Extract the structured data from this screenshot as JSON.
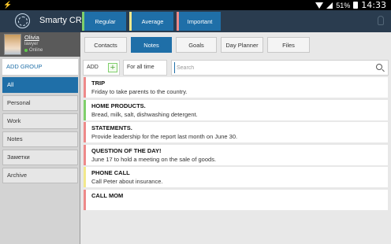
{
  "status_bar": {
    "battery": "51%",
    "time": "14:33"
  },
  "header": {
    "app_title": "Smarty CRM",
    "priorities": {
      "regular": "Regular",
      "average": "Average",
      "important": "Important"
    }
  },
  "profile": {
    "name": "Olivia",
    "role": "lawyer",
    "status": "Online"
  },
  "sidebar": {
    "add_group_label": "ADD GROUP",
    "groups": [
      "All",
      "Personal",
      "Work",
      "Notes",
      "Заметки",
      "Archive"
    ],
    "active_group": "All"
  },
  "tabs": [
    "Contacts",
    "Notes",
    "Goals",
    "Day Planner",
    "Files"
  ],
  "active_tab": "Notes",
  "toolbar": {
    "add_label": "ADD",
    "time_filter": "For all time",
    "search_placeholder": "Search"
  },
  "notes": [
    {
      "title": "TRIP",
      "body": "Friday to take parents to the country.",
      "priority": "important"
    },
    {
      "title": "HOME PRODUCTS.",
      "body": "Bread, milk, salt, dishwashing detergent.",
      "priority": "regular"
    },
    {
      "title": "STATEMENTS.",
      "body": "Provide leadership for the report last month on June 30.",
      "priority": "important"
    },
    {
      "title": "QUESTION OF THE DAY!",
      "body": "June 17 to hold a meeting on the sale of goods.",
      "priority": "important"
    },
    {
      "title": "PHONE CALL",
      "body": "Call Peter about insurance.",
      "priority": "average"
    },
    {
      "title": "CALL MOM",
      "body": "",
      "priority": "important"
    }
  ],
  "colors": {
    "accent": "#1f6fa8",
    "header_bg": "#2a3c4f",
    "regular": "#7fcf6b",
    "average": "#f2e88c",
    "important": "#ee8a8a"
  }
}
